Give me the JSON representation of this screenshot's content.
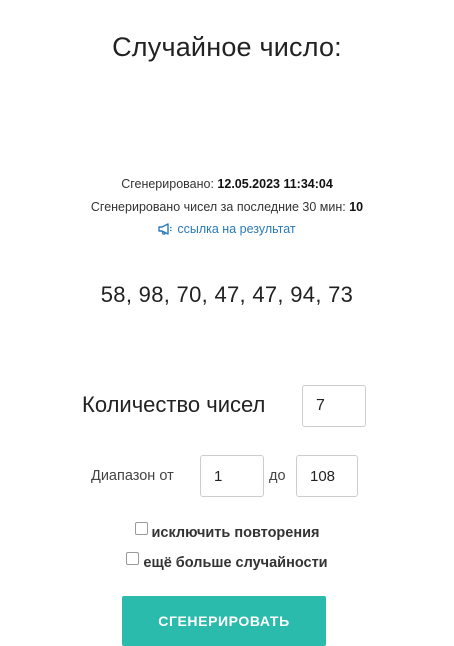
{
  "title": "Случайное число:",
  "meta": {
    "generated_label": "Сгенерировано:",
    "generated_value": "12.05.2023 11:34:04",
    "count_label": "Сгенерировано чисел за последние 30 мин:",
    "count_value": "10",
    "link_text": "ссылка на результат",
    "link_icon": "megaphone-icon"
  },
  "result": "58, 98, 70, 47, 47, 94, 73",
  "form": {
    "count_label": "Количество чисел",
    "count_value": "7",
    "range_from_label": "Диапазон от",
    "range_from_value": "1",
    "range_to_label": "до",
    "range_to_value": "108",
    "option_no_repeat": "исключить повторения",
    "option_no_repeat_checked": false,
    "option_more_random": "ещё больше случайности",
    "option_more_random_checked": false,
    "generate_button": "СГЕНЕРИРОВАТЬ"
  },
  "colors": {
    "accent": "#2bbbad",
    "link": "#2a7ab8",
    "text": "#222222"
  }
}
